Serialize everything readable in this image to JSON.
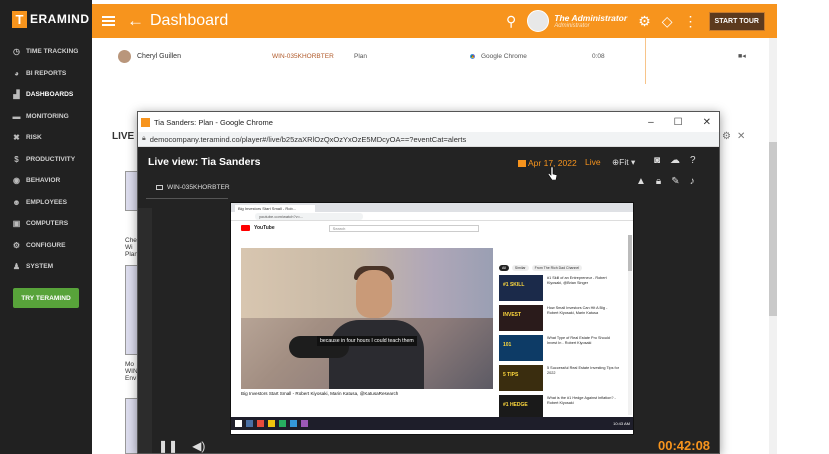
{
  "sidebar": {
    "logo_mark": "T",
    "logo_text": "ERAMIND",
    "items": [
      {
        "label": "TIME TRACKING",
        "icon": "clock-icon",
        "glyph": "◷"
      },
      {
        "label": "BI REPORTS",
        "icon": "chart-icon",
        "glyph": "◕"
      },
      {
        "label": "DASHBOARDS",
        "icon": "dashboard-icon",
        "glyph": "▟"
      },
      {
        "label": "MONITORING",
        "icon": "monitor-icon",
        "glyph": "▬"
      },
      {
        "label": "RISK",
        "icon": "warning-icon",
        "glyph": "✖"
      },
      {
        "label": "PRODUCTIVITY",
        "icon": "dollar-icon",
        "glyph": "$"
      },
      {
        "label": "BEHAVIOR",
        "icon": "eye-icon",
        "glyph": "◉"
      },
      {
        "label": "EMPLOYEES",
        "icon": "users-icon",
        "glyph": "☻"
      },
      {
        "label": "COMPUTERS",
        "icon": "computer-icon",
        "glyph": "▣"
      },
      {
        "label": "CONFIGURE",
        "icon": "gear-icon",
        "glyph": "⚙"
      },
      {
        "label": "SYSTEM",
        "icon": "system-icon",
        "glyph": "♟"
      }
    ],
    "try_button": "TRY TERAMIND"
  },
  "header": {
    "title": "Dashboard",
    "user_name": "The Administrator",
    "user_role": "Administrator",
    "start_tour": "START TOUR",
    "accent": "#f7941d"
  },
  "background": {
    "row": {
      "name": "Cheryl Guillen",
      "computer": "WIN-035KHORBTER",
      "plan": "Plan",
      "app": "Google Chrome",
      "duration": "0:08"
    },
    "live_label": "LIVE",
    "side_texts": [
      "Che",
      "Wi",
      "Plan",
      "Mo",
      "WIN",
      "Env"
    ]
  },
  "popup": {
    "window_title": "Tia Sanders: Plan - Google Chrome",
    "url": "democompany.teramind.co/player#/live/b25zaXRlOzQxOzYxOzE5MDcyOA==?eventCat=alerts",
    "viewer_title": "Live view: Tia Sanders",
    "date": "Apr 17, 2022",
    "live": "Live",
    "fit": "Fit",
    "computer_tab": "WIN-035KHORBTER",
    "timer": "00:42:08"
  },
  "screen": {
    "tab_label": "Big Investors Start Small - Rob...",
    "url": "youtube.com/watch?v=...",
    "yt_logo_text": "YouTube",
    "search_placeholder": "Search",
    "caption": "because in four hours I could teach them",
    "video_title": "Big Investors Start Small - Robert Kiyosaki, Marin Katusa, @KatusaResearch",
    "chips": [
      "All",
      "Similar",
      "From The Rich Dad Channel"
    ],
    "recommendations": [
      {
        "thumb": "#1 SKILL",
        "title": "#1 Skill of an Entrepreneur - Robert Kiyosaki, @Brian Singer"
      },
      {
        "thumb": "INVEST",
        "title": "How Small Investors Can Hit A Big - Robert Kiyosaki, Marin Katusa"
      },
      {
        "thumb": "101",
        "title": "What Type of Real Estate Pro Should Invest In - Robert Kiyosaki"
      },
      {
        "thumb": "5 TIPS",
        "title": "5 Successful Real Estate Investing Tips for 2022"
      },
      {
        "thumb": "#1 HEDGE",
        "title": "What is the #1 Hedge Against Inflation? - Robert Kiyosaki"
      }
    ],
    "taskbar_time": "10:43 AM"
  }
}
